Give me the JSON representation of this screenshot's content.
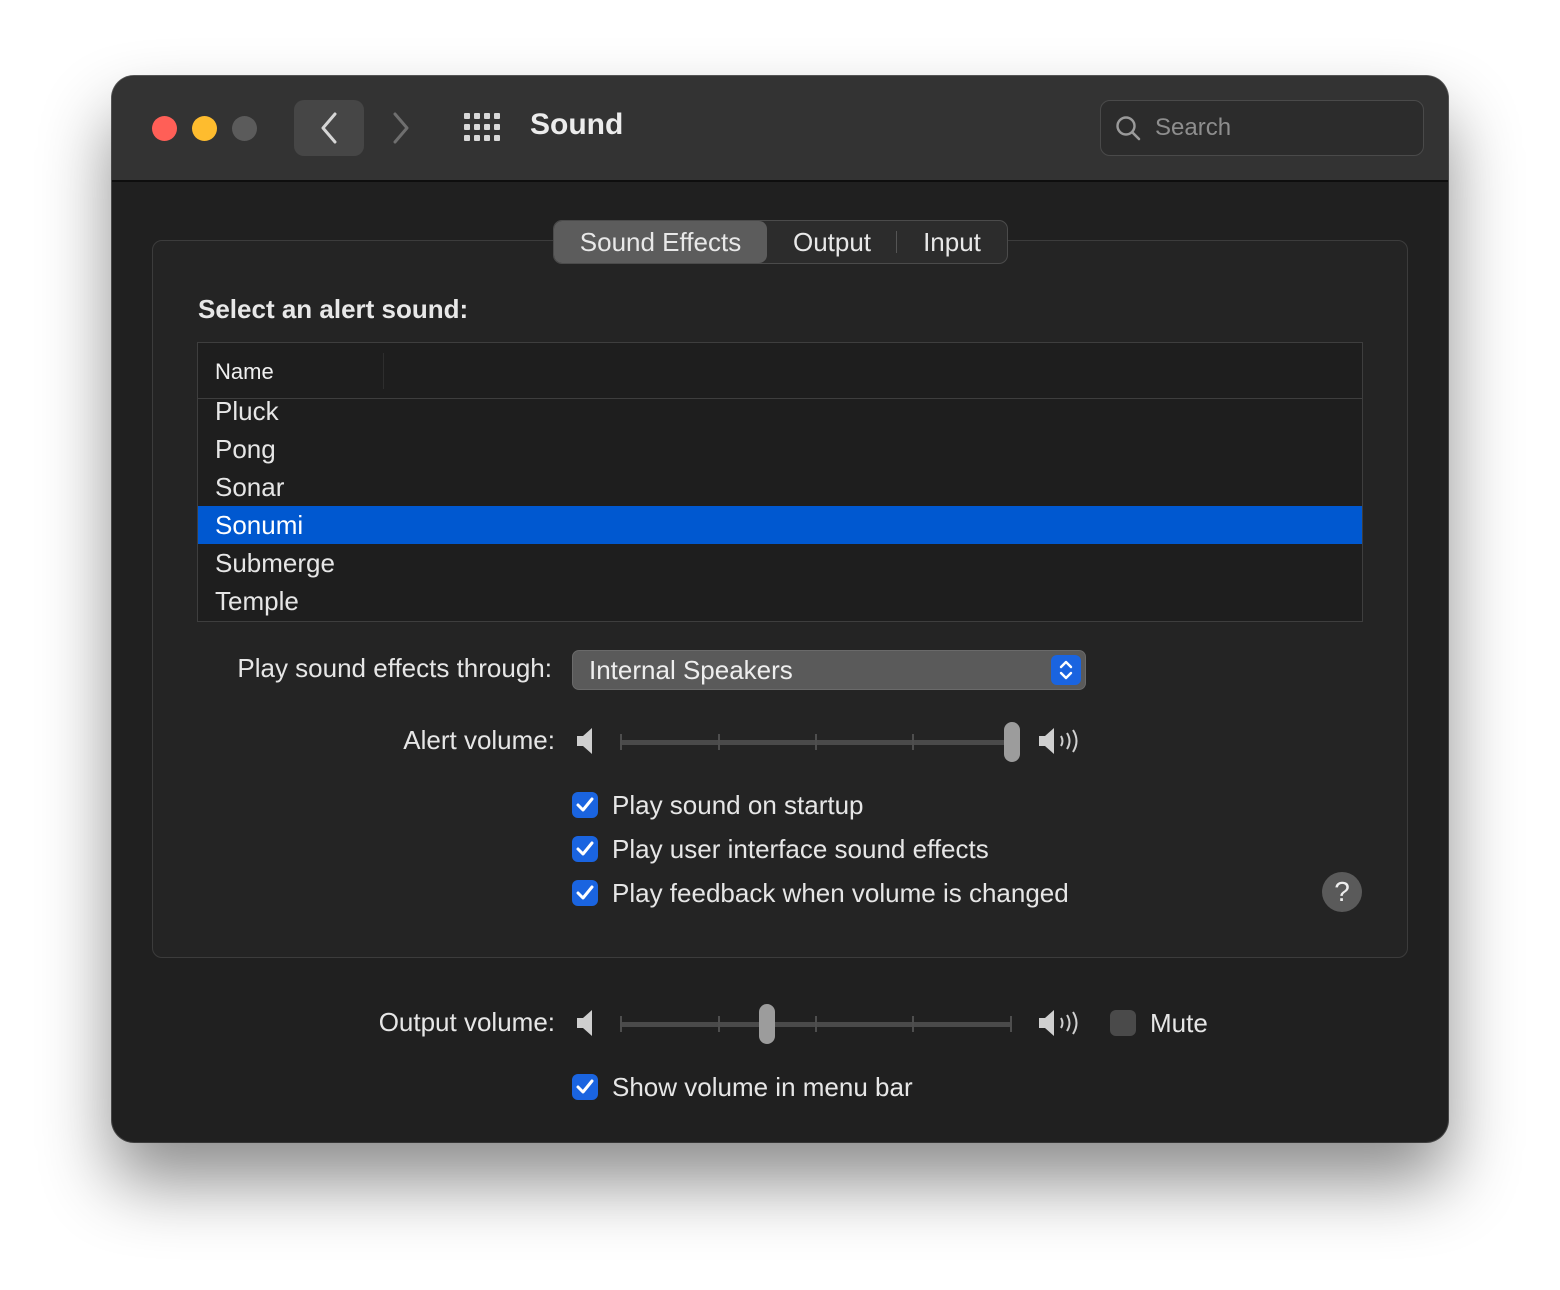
{
  "window": {
    "title": "Sound",
    "search_placeholder": "Search"
  },
  "tabs": [
    {
      "label": "Sound Effects",
      "selected": true
    },
    {
      "label": "Output",
      "selected": false
    },
    {
      "label": "Input",
      "selected": false
    }
  ],
  "sound_effects": {
    "section_label": "Select an alert sound:",
    "column_header": "Name",
    "sounds": [
      "Pluck",
      "Pong",
      "Sonar",
      "Sonumi",
      "Submerge",
      "Temple"
    ],
    "selected_sound": "Sonumi",
    "play_through_label": "Play sound effects through:",
    "play_through_value": "Internal Speakers",
    "alert_volume_label": "Alert volume:",
    "alert_volume": 1.0,
    "checkboxes": [
      {
        "label": "Play sound on startup",
        "checked": true
      },
      {
        "label": "Play user interface sound effects",
        "checked": true
      },
      {
        "label": "Play feedback when volume is changed",
        "checked": true
      }
    ],
    "help_label": "?"
  },
  "output": {
    "volume_label": "Output volume:",
    "volume": 0.375,
    "mute_label": "Mute",
    "mute_checked": false,
    "show_in_menu_bar_label": "Show volume in menu bar",
    "show_in_menu_bar_checked": true
  },
  "colors": {
    "accent": "#1a64e0",
    "selection": "#0058d0",
    "window_bg": "#202020",
    "titlebar_bg": "#333333",
    "close": "#ff5f57",
    "minimize": "#febc2e",
    "zoom_disabled": "#5b5b5b"
  }
}
